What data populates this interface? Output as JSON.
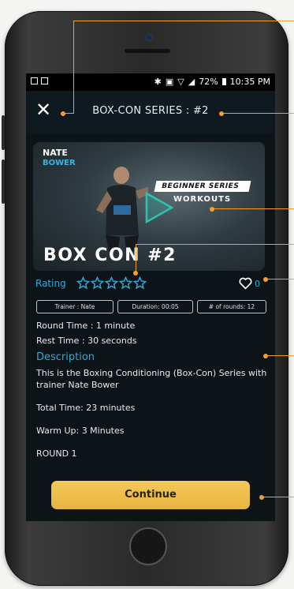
{
  "status_bar": {
    "battery": "72%",
    "time": "10:35 PM"
  },
  "header": {
    "title": "BOX-CON SERIES : #2"
  },
  "hero": {
    "trainer_first": "NATE",
    "trainer_last": "BOWER",
    "badge": "BEGINNER SERIES",
    "subtitle": "WORKOUTS",
    "workout_title": "BOX CON #2"
  },
  "rating": {
    "label": "Rating",
    "stars": 0,
    "max_stars": 5,
    "likes": "0"
  },
  "chips": [
    "Trainer : Nate",
    "Duration: 00:05",
    "# of rounds: 12"
  ],
  "details": {
    "round_time": "Round Time : 1 minute",
    "rest_time": "Rest Time : 30 seconds",
    "description_title": "Description",
    "description": "This is the Boxing Conditioning (Box-Con) Series with trainer Nate Bower",
    "total_time": "Total Time: 23 minutes",
    "warm_up": "Warm Up: 3 Minutes",
    "round1": "ROUND 1"
  },
  "continue_label": "Continue",
  "colors": {
    "accent": "#35a9d8",
    "button": "#f0c050",
    "annotation": "#f0a030",
    "screen_bg": "#0c1418"
  }
}
